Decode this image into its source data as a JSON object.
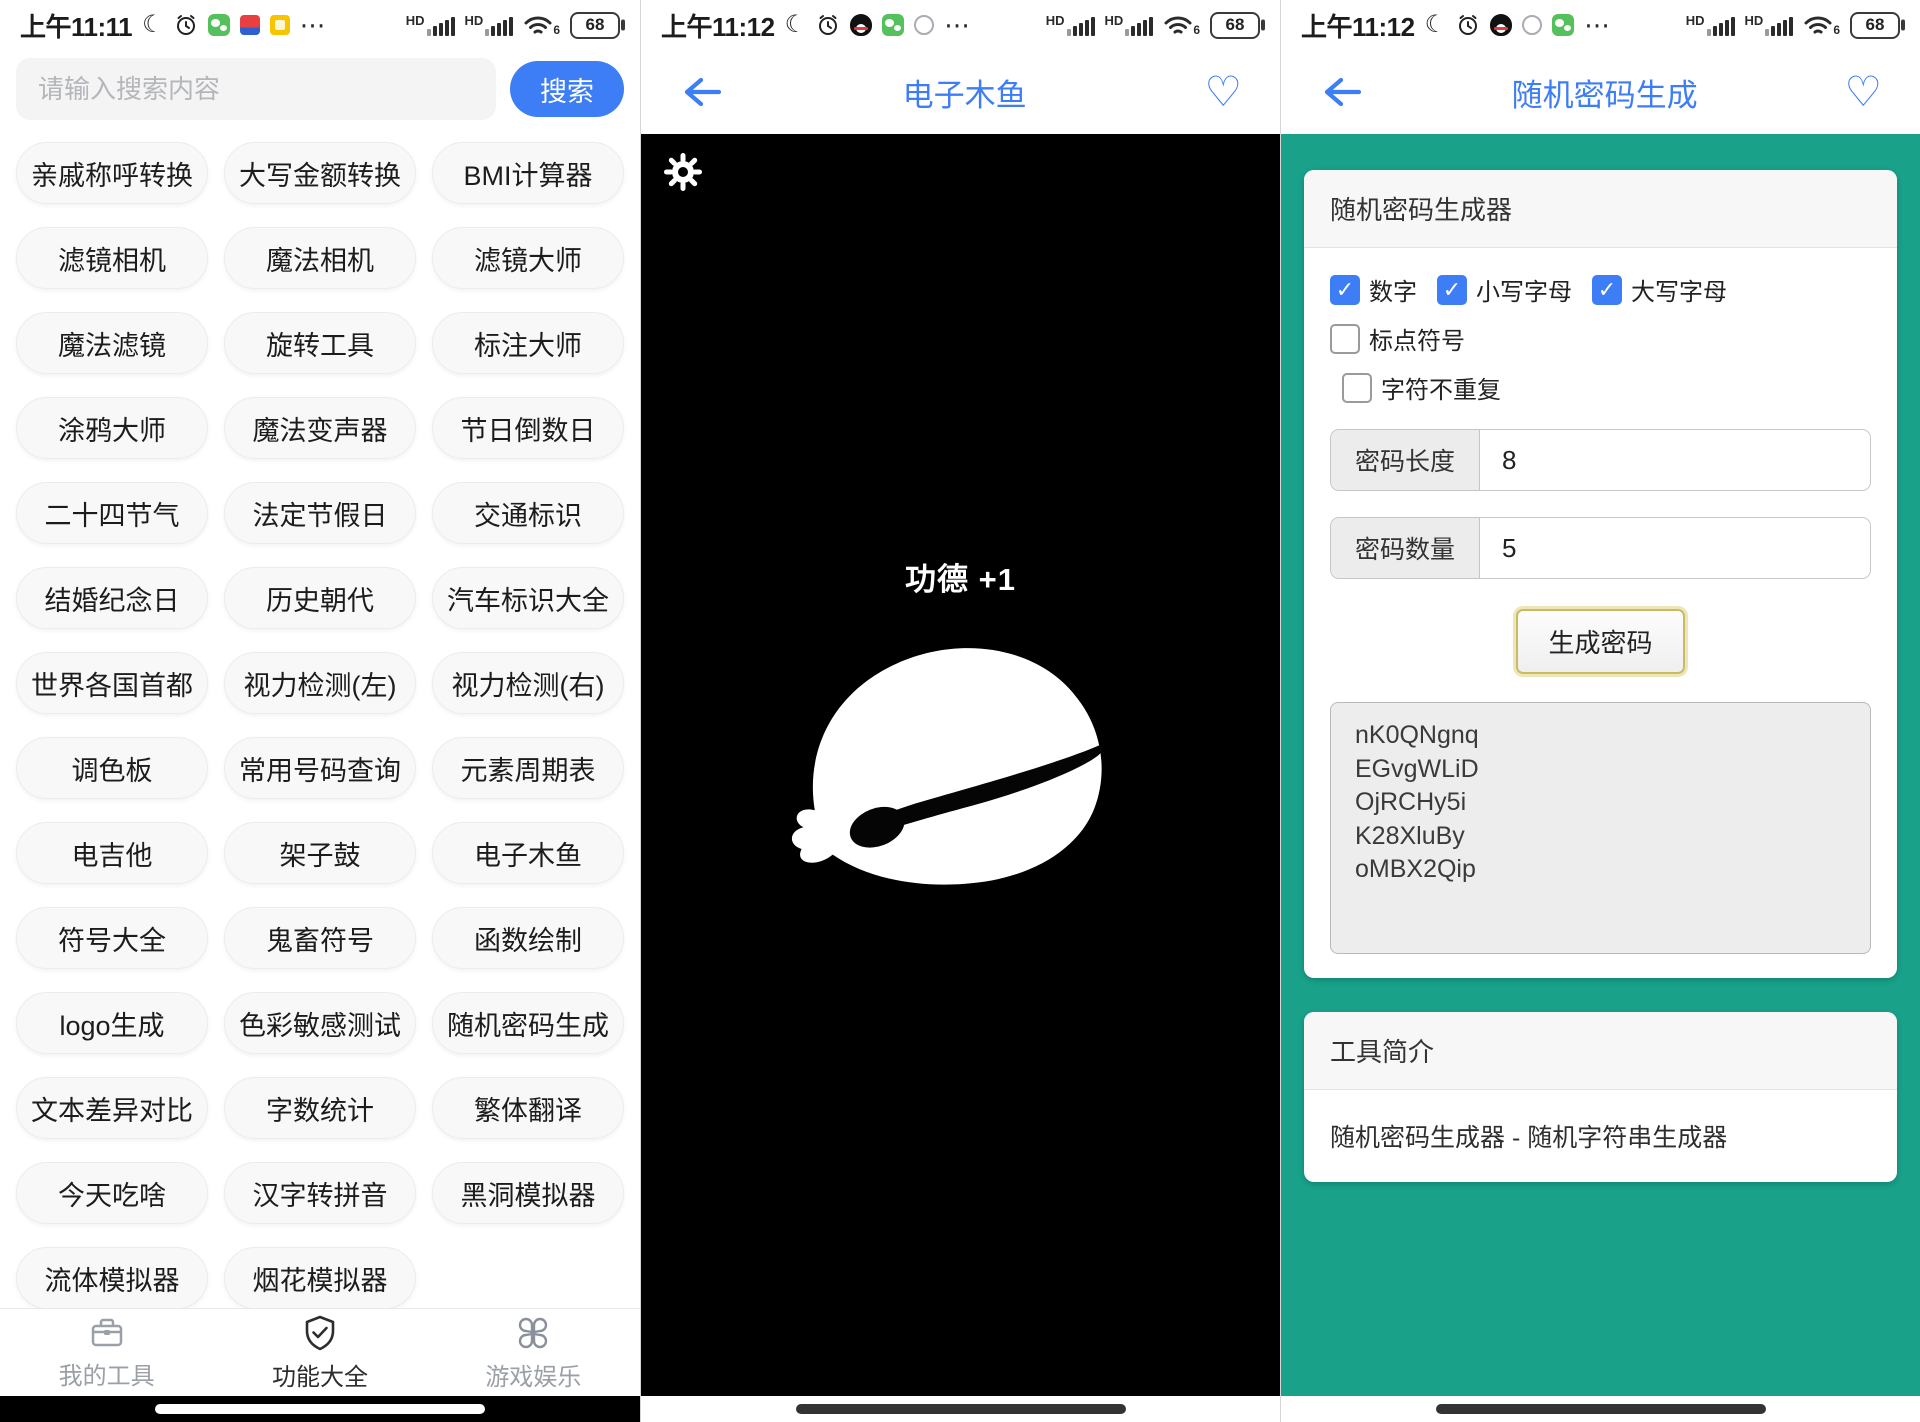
{
  "colors": {
    "accent": "#3d7df5",
    "teal": "#19a18a"
  },
  "left": {
    "status": {
      "time": "上午11:11",
      "battery": "68",
      "network": "HD"
    },
    "search": {
      "placeholder": "请输入搜索内容",
      "button_label": "搜索"
    },
    "tools": [
      "亲戚称呼转换",
      "大写金额转换",
      "BMI计算器",
      "滤镜相机",
      "魔法相机",
      "滤镜大师",
      "魔法滤镜",
      "旋转工具",
      "标注大师",
      "涂鸦大师",
      "魔法变声器",
      "节日倒数日",
      "二十四节气",
      "法定节假日",
      "交通标识",
      "结婚纪念日",
      "历史朝代",
      "汽车标识大全",
      "世界各国首都",
      "视力检测(左)",
      "视力检测(右)",
      "调色板",
      "常用号码查询",
      "元素周期表",
      "电吉他",
      "架子鼓",
      "电子木鱼",
      "符号大全",
      "鬼畜符号",
      "函数绘制",
      "logo生成",
      "色彩敏感测试",
      "随机密码生成",
      "文本差异对比",
      "字数统计",
      "繁体翻译",
      "今天吃啥",
      "汉字转拼音",
      "黑洞模拟器",
      "流体模拟器",
      "烟花模拟器"
    ],
    "nav": {
      "items": [
        {
          "label": "我的工具"
        },
        {
          "label": "功能大全"
        },
        {
          "label": "游戏娱乐"
        }
      ]
    }
  },
  "middle": {
    "status": {
      "time": "上午11:12",
      "battery": "68",
      "network": "HD"
    },
    "nav_title": "电子木鱼",
    "merit_text": "功德 +1"
  },
  "right": {
    "status": {
      "time": "上午11:12",
      "battery": "68",
      "network": "HD"
    },
    "nav_title": "随机密码生成",
    "card": {
      "title": "随机密码生成器",
      "checkbox_row1": [
        {
          "label": "数字",
          "checked": true
        },
        {
          "label": "小写字母",
          "checked": true
        },
        {
          "label": "大写字母",
          "checked": true
        },
        {
          "label": "标点符号",
          "checked": false
        }
      ],
      "checkbox_row2": [
        {
          "label": "字符不重复",
          "checked": false
        }
      ],
      "length_label": "密码长度",
      "length_value": "8",
      "count_label": "密码数量",
      "count_value": "5",
      "generate_label": "生成密码",
      "passwords": [
        "nK0QNgnq",
        "EGvgWLiD",
        "OjRCHy5i",
        "K28XluBy",
        "oMBX2Qip"
      ]
    },
    "intro": {
      "title": "工具简介",
      "body": "随机密码生成器 - 随机字符串生成器"
    }
  }
}
